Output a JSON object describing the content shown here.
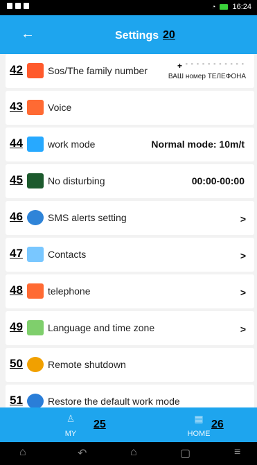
{
  "status_bar": {
    "time": "16:24"
  },
  "header": {
    "back_label": "←",
    "title": "Settings",
    "badge": "20"
  },
  "list": {
    "items": [
      {
        "num": "42",
        "icon": "sos-icon",
        "label": "Sos/The family number",
        "value": "",
        "plus": "+",
        "dashes": "- - - - - - - - - - -",
        "subvalue": "ВАШ номер ТЕЛЕФОНА",
        "arrow": "",
        "icon_color": "#ff5a2c"
      },
      {
        "num": "43",
        "icon": "voice-icon",
        "label": "Voice",
        "value": "",
        "plus": "",
        "dashes": "",
        "subvalue": "",
        "arrow": "",
        "icon_color": "#ff6a33"
      },
      {
        "num": "44",
        "icon": "work-mode-icon",
        "label": "work mode",
        "value": "Normal mode: 10m/t",
        "plus": "",
        "dashes": "",
        "subvalue": "",
        "arrow": "",
        "icon_color": "#27a9ff"
      },
      {
        "num": "45",
        "icon": "no-disturb-icon",
        "label": "No disturbing",
        "value": "00:00-00:00",
        "plus": "",
        "dashes": "",
        "subvalue": "",
        "arrow": "",
        "icon_color": "#1c5a2d"
      },
      {
        "num": "46",
        "icon": "sms-icon",
        "label": "SMS alerts setting",
        "value": "",
        "plus": "",
        "dashes": "",
        "subvalue": "",
        "arrow": ">",
        "icon_color": "#2f84d8"
      },
      {
        "num": "47",
        "icon": "contacts-icon",
        "label": "Contacts",
        "value": "",
        "plus": "",
        "dashes": "",
        "subvalue": "",
        "arrow": ">",
        "icon_color": "#79c7ff"
      },
      {
        "num": "48",
        "icon": "phone-icon",
        "label": "telephone",
        "value": "",
        "plus": "",
        "dashes": "",
        "subvalue": "",
        "arrow": ">",
        "icon_color": "#ff6a33"
      },
      {
        "num": "49",
        "icon": "language-icon",
        "label": "Language and time zone",
        "value": "",
        "plus": "",
        "dashes": "",
        "subvalue": "",
        "arrow": ">",
        "icon_color": "#7fcf6c"
      },
      {
        "num": "50",
        "icon": "power-icon",
        "label": "Remote shutdown",
        "value": "",
        "plus": "",
        "dashes": "",
        "subvalue": "",
        "arrow": "",
        "icon_color": "#f1a000"
      },
      {
        "num": "51",
        "icon": "restore-icon",
        "label": "Restore the default work mode",
        "value": "",
        "plus": "",
        "dashes": "",
        "subvalue": "",
        "arrow": "",
        "icon_color": "#2a7ed8"
      }
    ]
  },
  "bottom_nav": {
    "my_label": "MY",
    "home_label": "HOME",
    "my_badge": "25",
    "home_badge": "26"
  }
}
